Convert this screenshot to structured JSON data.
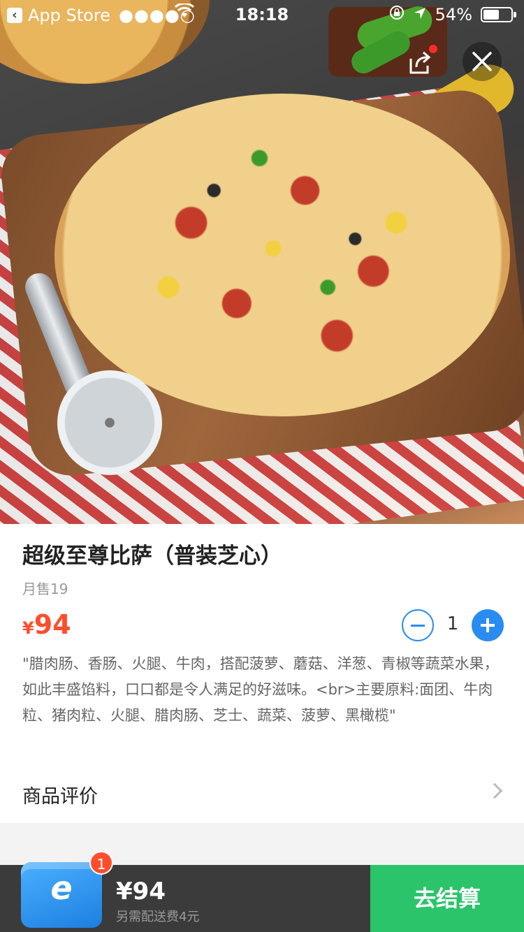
{
  "status_bar": {
    "back_app": "App Store",
    "signal": "●●●●○",
    "time": "18:18",
    "battery": "54%"
  },
  "product": {
    "title": "超级至尊比萨（普装芝心）",
    "monthly_sales": "月售19",
    "currency": "¥",
    "price": "94",
    "quantity": "1",
    "description": "\"腊肉肠、香肠、火腿、牛肉，搭配菠萝、蘑菇、洋葱、青椒等蔬菜水果，如此丰盛馅料，口口都是令人满足的好滋味。<br>主要原料:面团、牛肉粒、猪肉粒、火腿、腊肉肠、芝士、蔬菜、菠萝、黑橄榄\""
  },
  "reviews": {
    "label": "商品评价"
  },
  "cart": {
    "badge_count": "1",
    "total": "¥94",
    "delivery_note": "另需配送费4元",
    "checkout_label": "去结算"
  },
  "colors": {
    "price": "#ff4d2d",
    "accent_blue": "#2a8cf0",
    "checkout_green": "#2bc46b",
    "cart_bar": "#3b3b3b"
  },
  "icons": {
    "share": "share-icon",
    "close": "close-icon",
    "minus": "minus-icon",
    "plus": "plus-icon",
    "chevron": "chevron-right-icon",
    "cart": "cart-box-icon"
  }
}
